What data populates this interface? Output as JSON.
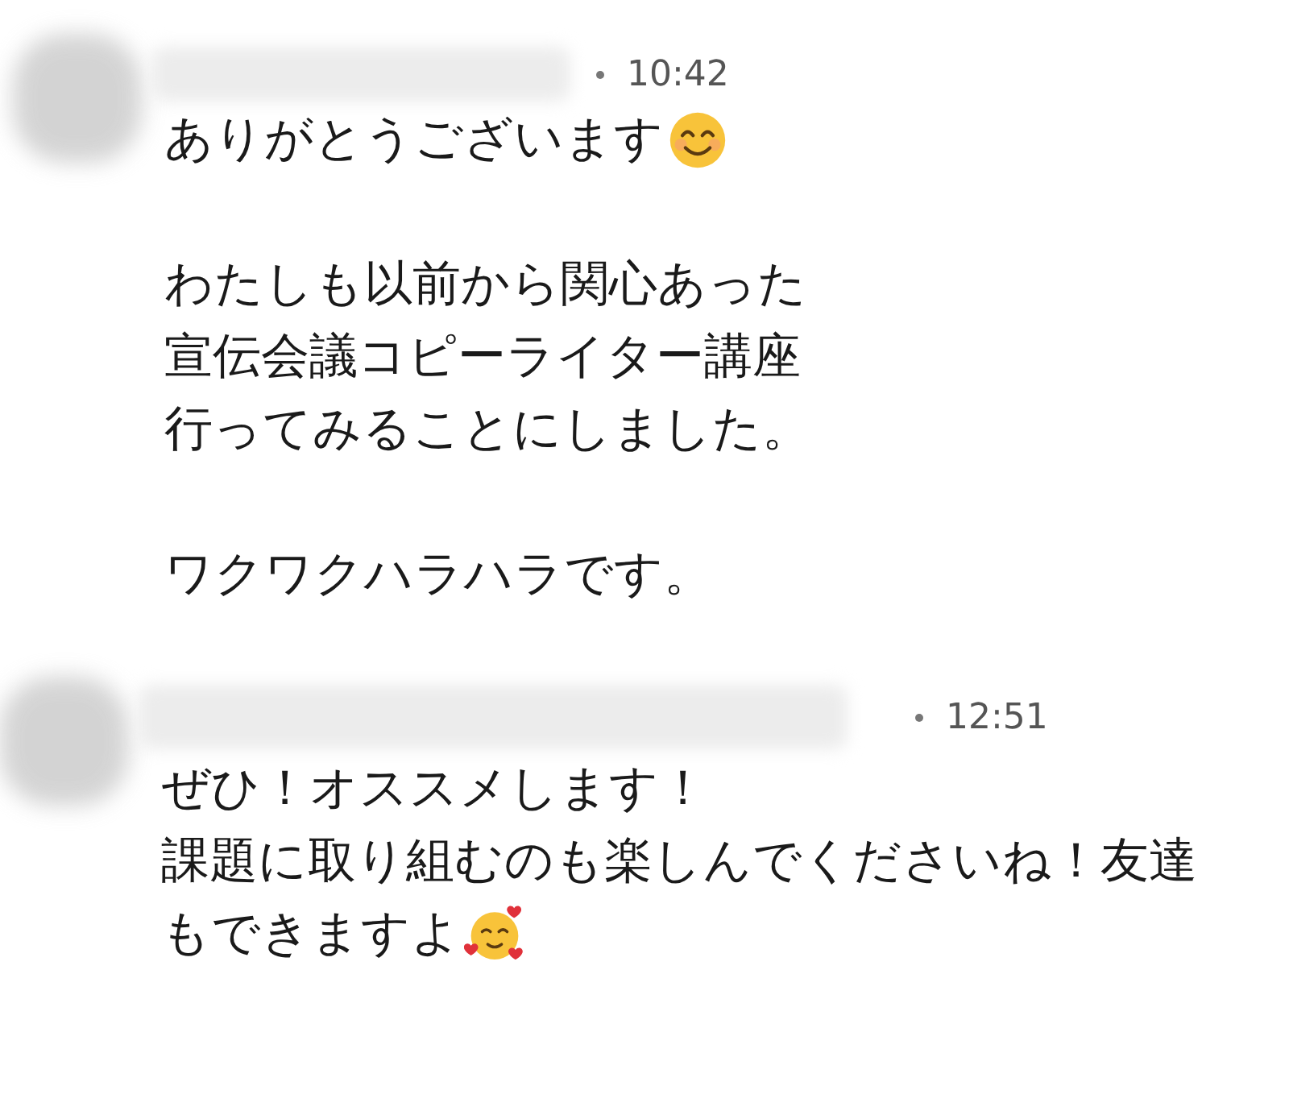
{
  "messages": [
    {
      "time": "10:42",
      "paragraphs": [
        [
          {
            "text": "ありがとうございます",
            "emoji": {
              "kind": "smiling"
            }
          }
        ],
        [
          {
            "text": "わたしも以前から関心あった"
          },
          {
            "text": "宣伝会議コピーライター講座"
          },
          {
            "text": "行ってみることにしました。"
          }
        ],
        [
          {
            "text": "ワクワクハラハラです。"
          }
        ]
      ]
    },
    {
      "time": "12:51",
      "paragraphs": [
        [
          {
            "text": "ぜひ！オススメします！"
          },
          {
            "text": "課題に取り組むのも楽しんでくださいね！友達"
          },
          {
            "text": "もできますよ",
            "emoji": {
              "kind": "hearts"
            }
          }
        ]
      ]
    }
  ]
}
